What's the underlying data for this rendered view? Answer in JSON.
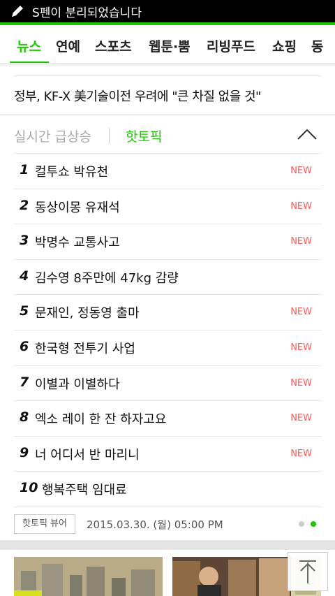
{
  "status_bar": {
    "notification": "S펜이 분리되었습니다"
  },
  "tabs": [
    "뉴스",
    "연예",
    "스포츠",
    "웹툰·뿜",
    "리빙푸드",
    "쇼핑",
    "동"
  ],
  "news": {
    "headline": "정부, KF-X 美기술이전 우려에 \"큰 차질 없을 것\""
  },
  "hot_topic": {
    "realtime_label": "실시간 급상승",
    "hot_label": "핫토픽",
    "items": [
      {
        "rank": "1",
        "title": "컬투쇼 박유천",
        "badge": "NEW"
      },
      {
        "rank": "2",
        "title": "동상이몽 유재석",
        "badge": "NEW"
      },
      {
        "rank": "3",
        "title": "박명수 교통사고",
        "badge": "NEW"
      },
      {
        "rank": "4",
        "title": "김수영 8주만에 47kg 감량",
        "badge": ""
      },
      {
        "rank": "5",
        "title": "문재인, 정동영 출마",
        "badge": "NEW"
      },
      {
        "rank": "6",
        "title": "한국형 전투기 사업",
        "badge": "NEW"
      },
      {
        "rank": "7",
        "title": "이별과 이별하다",
        "badge": "NEW"
      },
      {
        "rank": "8",
        "title": "엑소 레이 한 잔 하자고요",
        "badge": "NEW"
      },
      {
        "rank": "9",
        "title": "너 어디서 반 마리니",
        "badge": "NEW"
      },
      {
        "rank": "10",
        "title": "행복주택 임대료",
        "badge": ""
      }
    ],
    "viewer_button": "핫토픽 뷰어",
    "datetime": "2015.03.30. (월) 05:00 PM",
    "page_count": 2,
    "active_page": 2
  },
  "colors": {
    "accent": "#1ec800",
    "new_badge": "#ff5a5a"
  }
}
